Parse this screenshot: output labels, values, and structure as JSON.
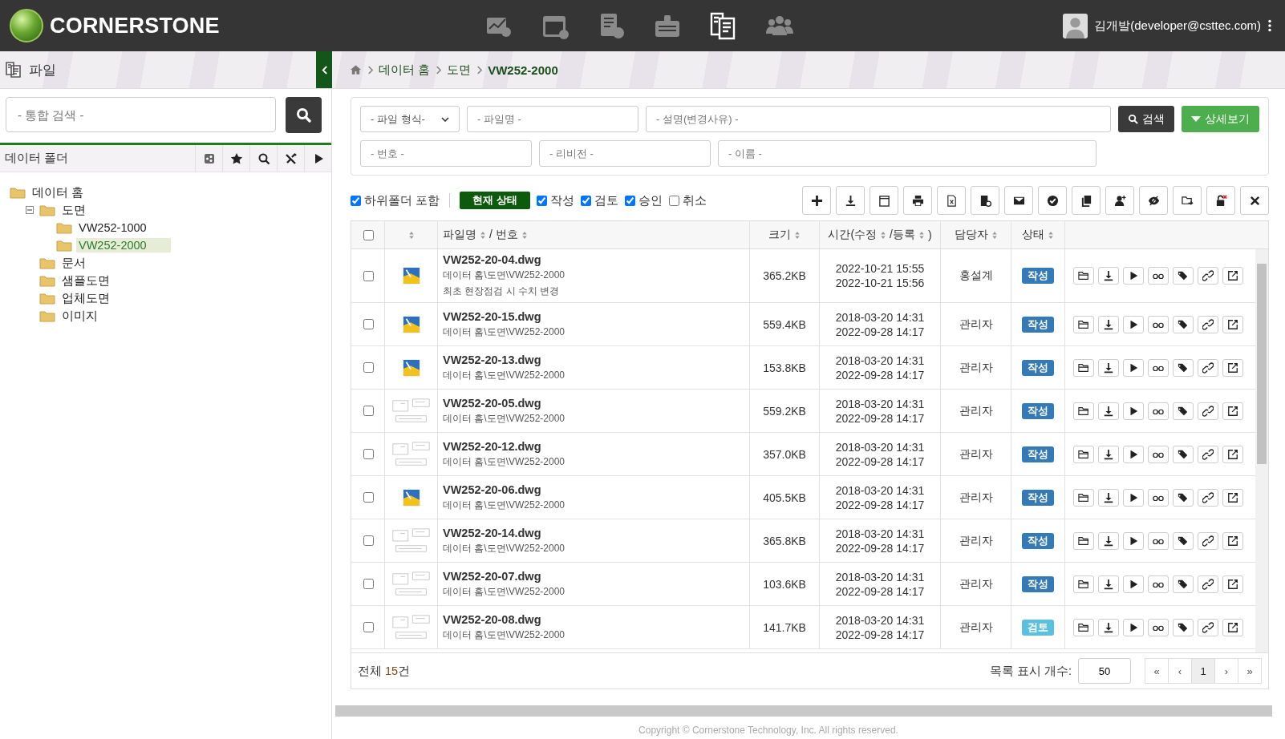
{
  "header": {
    "brand": "CORNERSTONE",
    "nav": [
      {
        "selected": false
      },
      {
        "selected": false
      },
      {
        "selected": false
      },
      {
        "selected": false
      },
      {
        "selected": true
      },
      {
        "selected": false
      }
    ],
    "user": "김개발(developer@csttec.com)"
  },
  "subbar": {
    "title": "파일",
    "breadcrumb": [
      "데이터 홈",
      "도면",
      "VW252-2000"
    ]
  },
  "sidebar": {
    "search": {
      "placeholder": "- 통합 검색 -"
    },
    "panel_title": "데이터 폴더",
    "tree": [
      {
        "label": "데이터 홈",
        "selected": false,
        "children": [
          {
            "label": "도면",
            "selected": false,
            "expanded": true,
            "children": [
              {
                "label": "VW252-1000",
                "selected": false
              },
              {
                "label": "VW252-2000",
                "selected": true
              }
            ]
          },
          {
            "label": "문서",
            "selected": false
          },
          {
            "label": "샘플도면",
            "selected": false
          },
          {
            "label": "업체도면",
            "selected": false
          },
          {
            "label": "이미지",
            "selected": false
          }
        ]
      }
    ]
  },
  "filters": {
    "file_type": "- 파일 형식-",
    "file_name": {
      "placeholder": "- 파일명 -"
    },
    "description": {
      "placeholder": "- 설명(변경사유) -"
    },
    "number": {
      "placeholder": "- 번호 -"
    },
    "revision": {
      "placeholder": "- 리비전 -"
    },
    "name": {
      "placeholder": "- 이름 -"
    },
    "search_button": "검색",
    "detail_button": "상세보기"
  },
  "options": {
    "subfolders": {
      "label": "하위폴더 포함",
      "checked": true
    },
    "status_tag": "현재 상태",
    "statuses": [
      {
        "label": "작성",
        "checked": true
      },
      {
        "label": "검토",
        "checked": true
      },
      {
        "label": "승인",
        "checked": true
      },
      {
        "label": "취소",
        "checked": false
      }
    ]
  },
  "table": {
    "select_all": {
      "checked": false
    },
    "columns": [
      {
        "segments": [
          "파일명",
          "/ 번호"
        ]
      },
      {
        "segments": [
          "크기"
        ]
      },
      {
        "segments": [
          "시간(수정",
          "/등록"
        ],
        "suffix": ")"
      },
      {
        "segments": [
          "담당자"
        ]
      },
      {
        "segments": [
          "상태"
        ]
      }
    ],
    "rows": [
      {
        "checked": false,
        "kind": "icon",
        "name": "VW252-20-04.dwg",
        "path": "데이터 홈\\도면\\VW252-2000",
        "note": "최초 현장점검 시 수치 변경",
        "size": "365.2KB",
        "modified": "2022-10-21 15:55",
        "registered": "2022-10-21 15:56",
        "owner": "홍설계",
        "status": {
          "label": "작성",
          "color": "#337ab7"
        }
      },
      {
        "checked": false,
        "kind": "icon",
        "name": "VW252-20-15.dwg",
        "path": "데이터 홈\\도면\\VW252-2000",
        "size": "559.4KB",
        "modified": "2018-03-20 14:31",
        "registered": "2022-09-28 14:17",
        "owner": "관리자",
        "status": {
          "label": "작성",
          "color": "#337ab7"
        }
      },
      {
        "checked": false,
        "kind": "icon",
        "name": "VW252-20-13.dwg",
        "path": "데이터 홈\\도면\\VW252-2000",
        "size": "153.8KB",
        "modified": "2018-03-20 14:31",
        "registered": "2022-09-28 14:17",
        "owner": "관리자",
        "status": {
          "label": "작성",
          "color": "#337ab7"
        }
      },
      {
        "checked": false,
        "kind": "sketch",
        "name": "VW252-20-05.dwg",
        "path": "데이터 홈\\도면\\VW252-2000",
        "size": "559.2KB",
        "modified": "2018-03-20 14:31",
        "registered": "2022-09-28 14:17",
        "owner": "관리자",
        "status": {
          "label": "작성",
          "color": "#337ab7"
        }
      },
      {
        "checked": false,
        "kind": "sketch",
        "name": "VW252-20-12.dwg",
        "path": "데이터 홈\\도면\\VW252-2000",
        "size": "357.0KB",
        "modified": "2018-03-20 14:31",
        "registered": "2022-09-28 14:17",
        "owner": "관리자",
        "status": {
          "label": "작성",
          "color": "#337ab7"
        }
      },
      {
        "checked": false,
        "kind": "icon",
        "name": "VW252-20-06.dwg",
        "path": "데이터 홈\\도면\\VW252-2000",
        "size": "405.5KB",
        "modified": "2018-03-20 14:31",
        "registered": "2022-09-28 14:17",
        "owner": "관리자",
        "status": {
          "label": "작성",
          "color": "#337ab7"
        }
      },
      {
        "checked": false,
        "kind": "sketch",
        "name": "VW252-20-14.dwg",
        "path": "데이터 홈\\도면\\VW252-2000",
        "size": "365.8KB",
        "modified": "2018-03-20 14:31",
        "registered": "2022-09-28 14:17",
        "owner": "관리자",
        "status": {
          "label": "작성",
          "color": "#337ab7"
        }
      },
      {
        "checked": false,
        "kind": "sketch",
        "name": "VW252-20-07.dwg",
        "path": "데이터 홈\\도면\\VW252-2000",
        "size": "103.6KB",
        "modified": "2018-03-20 14:31",
        "registered": "2022-09-28 14:17",
        "owner": "관리자",
        "status": {
          "label": "작성",
          "color": "#337ab7"
        }
      },
      {
        "checked": false,
        "kind": "sketch",
        "name": "VW252-20-08.dwg",
        "path": "데이터 홈\\도면\\VW252-2000",
        "size": "141.7KB",
        "modified": "2018-03-20 14:31",
        "registered": "2022-09-28 14:17",
        "owner": "관리자",
        "status": {
          "label": "검토",
          "color": "#5bc0de"
        }
      }
    ],
    "total": {
      "prefix": "전체 ",
      "count": "15",
      "suffix": "건"
    },
    "page_size_label": "목록 표시 개수:",
    "page_size": "50",
    "pages": [
      {
        "label": "«",
        "selected": false
      },
      {
        "label": "‹",
        "selected": false
      },
      {
        "label": "1",
        "selected": true
      },
      {
        "label": "›",
        "selected": false
      },
      {
        "label": "»",
        "selected": false
      }
    ]
  },
  "footer": "Copyright © Cornerstone Technology, Inc. All rights reserved."
}
